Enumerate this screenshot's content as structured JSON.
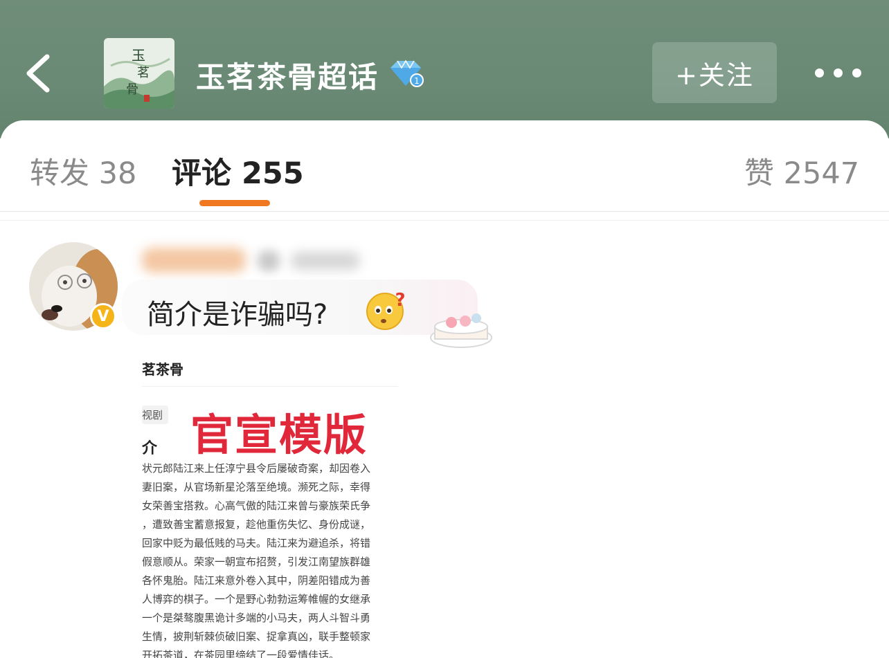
{
  "header": {
    "topic_title": "玉茗茶骨超话",
    "logo_text": "玉茗茶骨",
    "follow_label": "+关注",
    "level_badge": "1",
    "accent": "#6a8a75"
  },
  "tabs": {
    "repost": "转发 38",
    "comments": "评论 255",
    "likes": "赞 2547",
    "underline_color": "#f07820"
  },
  "comment": {
    "text": "简介是诈骗吗?",
    "verified_badge": "V"
  },
  "attached_image": {
    "title": "茗茶骨",
    "tag": "视剧",
    "overlay_title": "官宣模版",
    "heading": "介",
    "lines": [
      "状元郎陆江来上任淳宁县令后屡破奇案，却因卷入",
      "妻旧案，从官场新星沦落至绝境。濒死之际，幸得",
      "女荣善宝搭救。心高气傲的陆江来曾与豪族荣氏争",
      "，遭致善宝蓄意报复，趁他重伤失忆、身份成谜，",
      "回家中贬为最低贱的马夫。陆江来为避追杀，将错",
      "假意顺从。荣家一朝宣布招赘，引发江南望族群雄",
      "各怀鬼胎。陆江来意外卷入其中，阴差阳错成为善",
      "人博弈的棋子。一个是野心勃勃运筹帷幄的女继承",
      "一个是桀骜腹黑诡计多端的小马夫，两人斗智斗勇",
      "生情，披荆斩棘侦破旧案、捉拿真凶，联手整顿家",
      "开拓茶道，在茶园里缔结了一段爱情佳话。"
    ]
  }
}
